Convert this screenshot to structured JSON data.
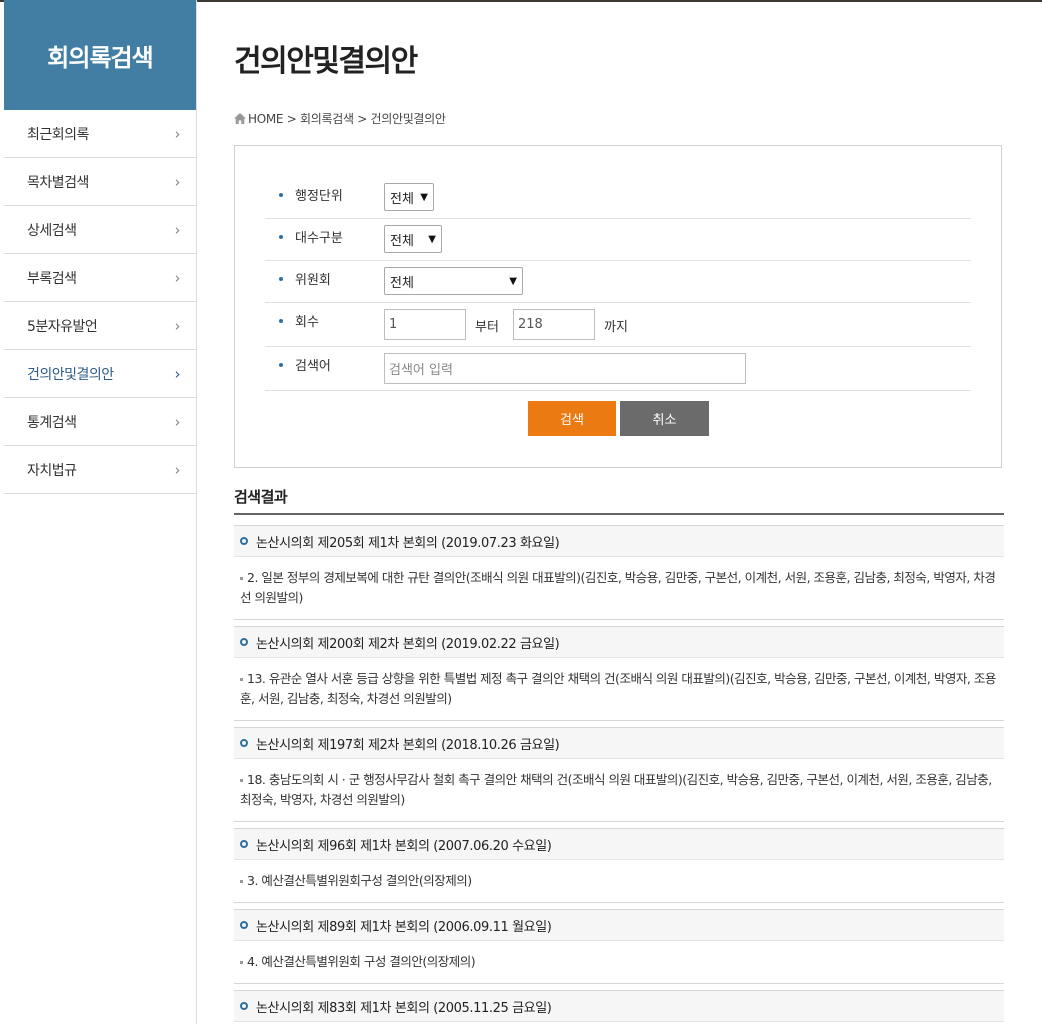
{
  "sidebar": {
    "title": "회의록검색",
    "items": [
      {
        "label": "최근회의록"
      },
      {
        "label": "목차별검색"
      },
      {
        "label": "상세검색"
      },
      {
        "label": "부록검색"
      },
      {
        "label": "5분자유발언"
      },
      {
        "label": "건의안및결의안"
      },
      {
        "label": "통계검색"
      },
      {
        "label": "자치법규"
      }
    ],
    "active_index": 5
  },
  "page": {
    "title": "건의안및결의안",
    "breadcrumb": "HOME > 회의록검색 > 건의안및결의안"
  },
  "form": {
    "admin_unit": {
      "label": "행정단위",
      "value": "전체"
    },
    "term": {
      "label": "대수구분",
      "value": "전체"
    },
    "committee": {
      "label": "위원회",
      "value": "전체"
    },
    "session": {
      "label": "회수",
      "from": "1",
      "from_suffix": "부터",
      "to": "218",
      "to_suffix": "까지"
    },
    "keyword": {
      "label": "검색어",
      "placeholder": "검색어 입력"
    },
    "search_button": "검색",
    "cancel_button": "취소"
  },
  "results": {
    "title": "검색결과",
    "meetings": [
      {
        "heading": "논산시의회 제205회 제1차 본회의 (2019.07.23 화요일)",
        "item": "2. 일본 정부의 경제보복에 대한 규탄 결의안(조배식 의원 대표발의)(김진호, 박승용, 김만중, 구본선, 이계천, 서원, 조용훈, 김남충, 최정숙, 박영자, 차경선 의원발의)"
      },
      {
        "heading": "논산시의회 제200회 제2차 본회의 (2019.02.22 금요일)",
        "item": "13. 유관순 열사 서훈 등급 상향을 위한 특별법 제정 촉구 결의안 채택의 건(조배식 의원 대표발의)(김진호, 박승용, 김만중, 구본선, 이계천, 박영자, 조용훈, 서원, 김남충, 최정숙, 차경선 의원발의)"
      },
      {
        "heading": "논산시의회 제197회 제2차 본회의 (2018.10.26 금요일)",
        "item": "18. 충남도의회 시 · 군 행정사무감사 철회 촉구 결의안 채택의 건(조배식 의원 대표발의)(김진호, 박승용, 김만중, 구본선, 이계천, 서원, 조용훈, 김남충, 최정숙, 박영자, 차경선 의원발의)"
      },
      {
        "heading": "논산시의회 제96회 제1차 본회의 (2007.06.20 수요일)",
        "item": "3. 예산결산특별위원회구성 결의안(의장제의)"
      },
      {
        "heading": "논산시의회 제89회 제1차 본회의 (2006.09.11 월요일)",
        "item": "4. 예산결산특별위원회 구성 결의안(의장제의)"
      },
      {
        "heading": "논산시의회 제83회 제1차 본회의 (2005.11.25 금요일)",
        "item": ""
      }
    ]
  },
  "colors": {
    "sidebar_header": "#427ea3",
    "search_button": "#ec7a13",
    "cancel_button": "#6b6b6b",
    "accent": "#2f6fa0"
  }
}
